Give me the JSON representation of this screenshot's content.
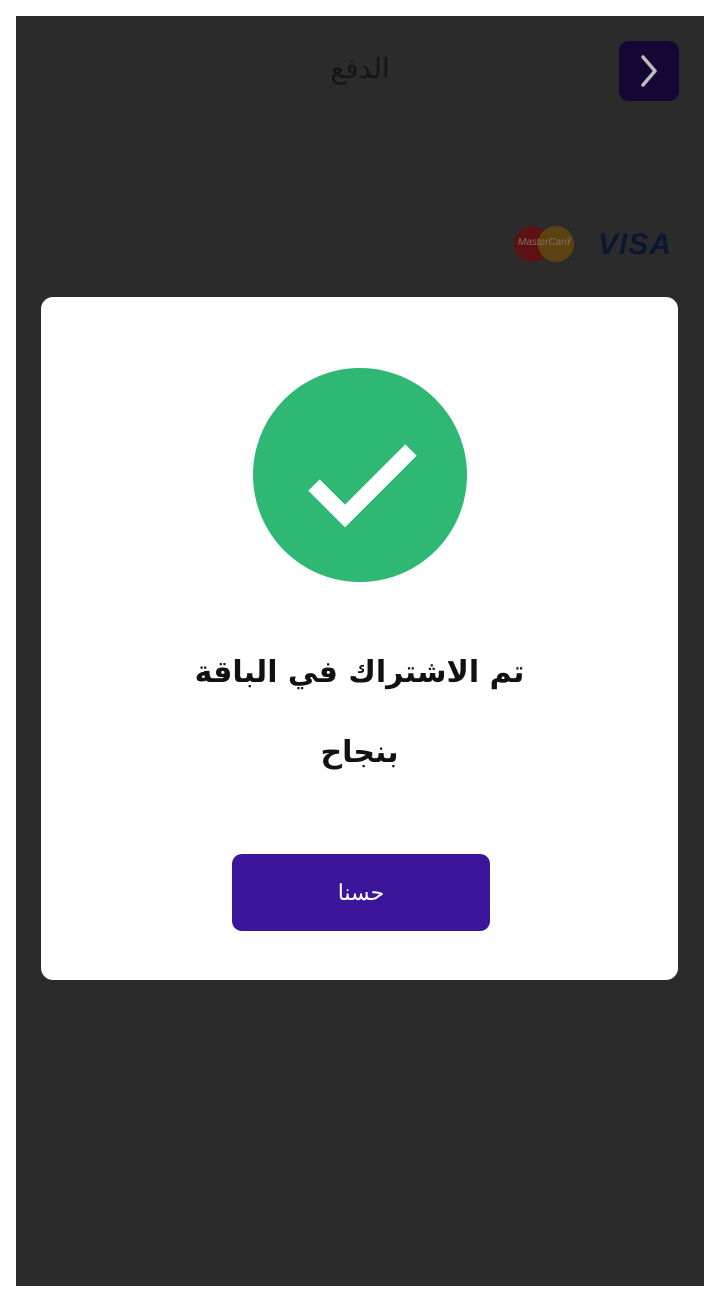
{
  "header": {
    "title": "الدفع",
    "back_icon": "chevron-right-icon"
  },
  "payment_methods": {
    "visa_label": "VISA",
    "mastercard_label": "MasterCard"
  },
  "dialog": {
    "icon": "check-circle-icon",
    "message_line1": "تم الاشتراك في الباقة",
    "message_line2": "بنجاح",
    "ok_label": "حسنا"
  },
  "colors": {
    "overlay_background": "#2b2b2b",
    "success_green": "#2eb873",
    "button_purple": "#3c169a",
    "back_button_bg": "#160633"
  }
}
